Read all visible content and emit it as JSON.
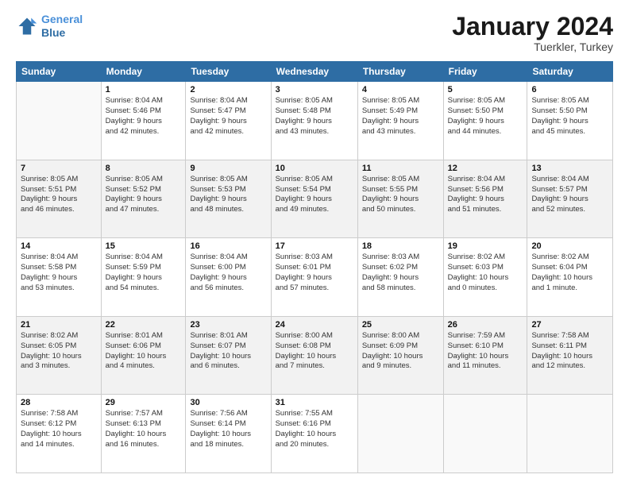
{
  "header": {
    "logo_line1": "General",
    "logo_line2": "Blue",
    "month_title": "January 2024",
    "subtitle": "Tuerkler, Turkey"
  },
  "weekdays": [
    "Sunday",
    "Monday",
    "Tuesday",
    "Wednesday",
    "Thursday",
    "Friday",
    "Saturday"
  ],
  "weeks": [
    [
      {
        "day": "",
        "text": ""
      },
      {
        "day": "1",
        "text": "Sunrise: 8:04 AM\nSunset: 5:46 PM\nDaylight: 9 hours\nand 42 minutes."
      },
      {
        "day": "2",
        "text": "Sunrise: 8:04 AM\nSunset: 5:47 PM\nDaylight: 9 hours\nand 42 minutes."
      },
      {
        "day": "3",
        "text": "Sunrise: 8:05 AM\nSunset: 5:48 PM\nDaylight: 9 hours\nand 43 minutes."
      },
      {
        "day": "4",
        "text": "Sunrise: 8:05 AM\nSunset: 5:49 PM\nDaylight: 9 hours\nand 43 minutes."
      },
      {
        "day": "5",
        "text": "Sunrise: 8:05 AM\nSunset: 5:50 PM\nDaylight: 9 hours\nand 44 minutes."
      },
      {
        "day": "6",
        "text": "Sunrise: 8:05 AM\nSunset: 5:50 PM\nDaylight: 9 hours\nand 45 minutes."
      }
    ],
    [
      {
        "day": "7",
        "text": "Sunrise: 8:05 AM\nSunset: 5:51 PM\nDaylight: 9 hours\nand 46 minutes."
      },
      {
        "day": "8",
        "text": "Sunrise: 8:05 AM\nSunset: 5:52 PM\nDaylight: 9 hours\nand 47 minutes."
      },
      {
        "day": "9",
        "text": "Sunrise: 8:05 AM\nSunset: 5:53 PM\nDaylight: 9 hours\nand 48 minutes."
      },
      {
        "day": "10",
        "text": "Sunrise: 8:05 AM\nSunset: 5:54 PM\nDaylight: 9 hours\nand 49 minutes."
      },
      {
        "day": "11",
        "text": "Sunrise: 8:05 AM\nSunset: 5:55 PM\nDaylight: 9 hours\nand 50 minutes."
      },
      {
        "day": "12",
        "text": "Sunrise: 8:04 AM\nSunset: 5:56 PM\nDaylight: 9 hours\nand 51 minutes."
      },
      {
        "day": "13",
        "text": "Sunrise: 8:04 AM\nSunset: 5:57 PM\nDaylight: 9 hours\nand 52 minutes."
      }
    ],
    [
      {
        "day": "14",
        "text": "Sunrise: 8:04 AM\nSunset: 5:58 PM\nDaylight: 9 hours\nand 53 minutes."
      },
      {
        "day": "15",
        "text": "Sunrise: 8:04 AM\nSunset: 5:59 PM\nDaylight: 9 hours\nand 54 minutes."
      },
      {
        "day": "16",
        "text": "Sunrise: 8:04 AM\nSunset: 6:00 PM\nDaylight: 9 hours\nand 56 minutes."
      },
      {
        "day": "17",
        "text": "Sunrise: 8:03 AM\nSunset: 6:01 PM\nDaylight: 9 hours\nand 57 minutes."
      },
      {
        "day": "18",
        "text": "Sunrise: 8:03 AM\nSunset: 6:02 PM\nDaylight: 9 hours\nand 58 minutes."
      },
      {
        "day": "19",
        "text": "Sunrise: 8:02 AM\nSunset: 6:03 PM\nDaylight: 10 hours\nand 0 minutes."
      },
      {
        "day": "20",
        "text": "Sunrise: 8:02 AM\nSunset: 6:04 PM\nDaylight: 10 hours\nand 1 minute."
      }
    ],
    [
      {
        "day": "21",
        "text": "Sunrise: 8:02 AM\nSunset: 6:05 PM\nDaylight: 10 hours\nand 3 minutes."
      },
      {
        "day": "22",
        "text": "Sunrise: 8:01 AM\nSunset: 6:06 PM\nDaylight: 10 hours\nand 4 minutes."
      },
      {
        "day": "23",
        "text": "Sunrise: 8:01 AM\nSunset: 6:07 PM\nDaylight: 10 hours\nand 6 minutes."
      },
      {
        "day": "24",
        "text": "Sunrise: 8:00 AM\nSunset: 6:08 PM\nDaylight: 10 hours\nand 7 minutes."
      },
      {
        "day": "25",
        "text": "Sunrise: 8:00 AM\nSunset: 6:09 PM\nDaylight: 10 hours\nand 9 minutes."
      },
      {
        "day": "26",
        "text": "Sunrise: 7:59 AM\nSunset: 6:10 PM\nDaylight: 10 hours\nand 11 minutes."
      },
      {
        "day": "27",
        "text": "Sunrise: 7:58 AM\nSunset: 6:11 PM\nDaylight: 10 hours\nand 12 minutes."
      }
    ],
    [
      {
        "day": "28",
        "text": "Sunrise: 7:58 AM\nSunset: 6:12 PM\nDaylight: 10 hours\nand 14 minutes."
      },
      {
        "day": "29",
        "text": "Sunrise: 7:57 AM\nSunset: 6:13 PM\nDaylight: 10 hours\nand 16 minutes."
      },
      {
        "day": "30",
        "text": "Sunrise: 7:56 AM\nSunset: 6:14 PM\nDaylight: 10 hours\nand 18 minutes."
      },
      {
        "day": "31",
        "text": "Sunrise: 7:55 AM\nSunset: 6:16 PM\nDaylight: 10 hours\nand 20 minutes."
      },
      {
        "day": "",
        "text": ""
      },
      {
        "day": "",
        "text": ""
      },
      {
        "day": "",
        "text": ""
      }
    ]
  ]
}
